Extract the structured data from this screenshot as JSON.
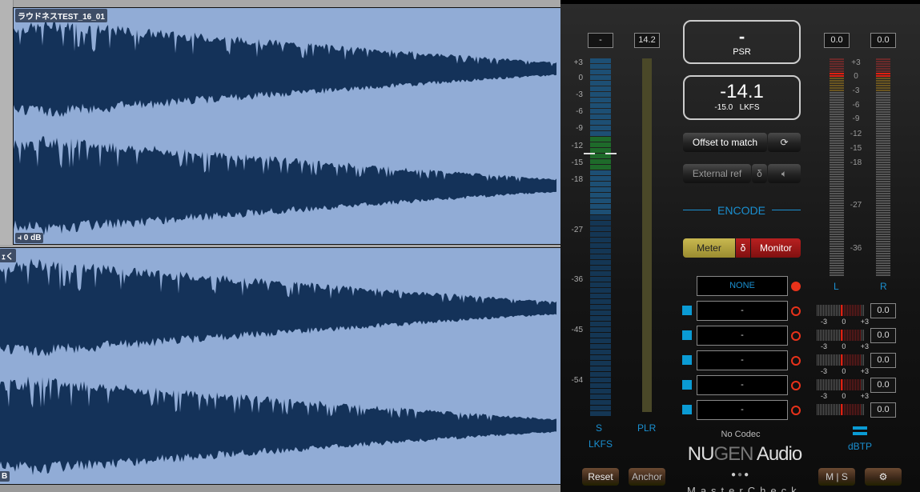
{
  "daw": {
    "clip1_name": "ラウドネスTEST_16_01",
    "clip1_gain": "0 dB",
    "clip2_name_fragment": "ｪく",
    "clip2_gain_fragment": "B"
  },
  "plugin": {
    "short_term_value": "-",
    "plr_value": "14.2",
    "psr_value": "-",
    "psr_label": "PSR",
    "integrated_value": "-14.1",
    "target_value": "-15.0",
    "target_unit": "LKFS",
    "offset_button": "Offset to match",
    "external_ref_button": "External ref",
    "delta_symbol": "δ",
    "encode_heading": "ENCODE",
    "meter_button": "Meter",
    "monitor_button": "Monitor",
    "codec_slots": [
      "NONE",
      "-",
      "-",
      "-",
      "-",
      "-"
    ],
    "no_codec_label": "No Codec",
    "brand_nu": "NU",
    "brand_gen": "GEN",
    "brand_audio": " Audio",
    "product_name": "MasterCheck",
    "s_label": "S",
    "plr_label": "PLR",
    "lkfs_label": "LKFS",
    "l_label": "L",
    "r_label": "R",
    "dbtp_label": "dBTP",
    "peak_l": "0.0",
    "peak_r": "0.0",
    "codec_peaks": [
      "0.0",
      "0.0",
      "0.0",
      "0.0",
      "0.0"
    ],
    "mini_scale": [
      "-3",
      "0",
      "+3"
    ],
    "reset_button": "Reset",
    "anchor_button": "Anchor",
    "ms_button": "M | S",
    "lkfs_scale": [
      "+3",
      "0",
      "-3",
      "-6",
      "-9",
      "-12",
      "-15",
      "-18",
      "-27",
      "-36",
      "-45",
      "-54"
    ],
    "dbtp_scale": [
      "+3",
      "0",
      "-3",
      "-6",
      "-9",
      "-12",
      "-15",
      "-18",
      "-27",
      "-36"
    ],
    "short_term_level_lkfs": -14.1,
    "colors": {
      "accent": "#1a8fd0",
      "meter_button": "#b8a840",
      "monitor_button": "#a01818",
      "record": "#e8321a"
    }
  }
}
